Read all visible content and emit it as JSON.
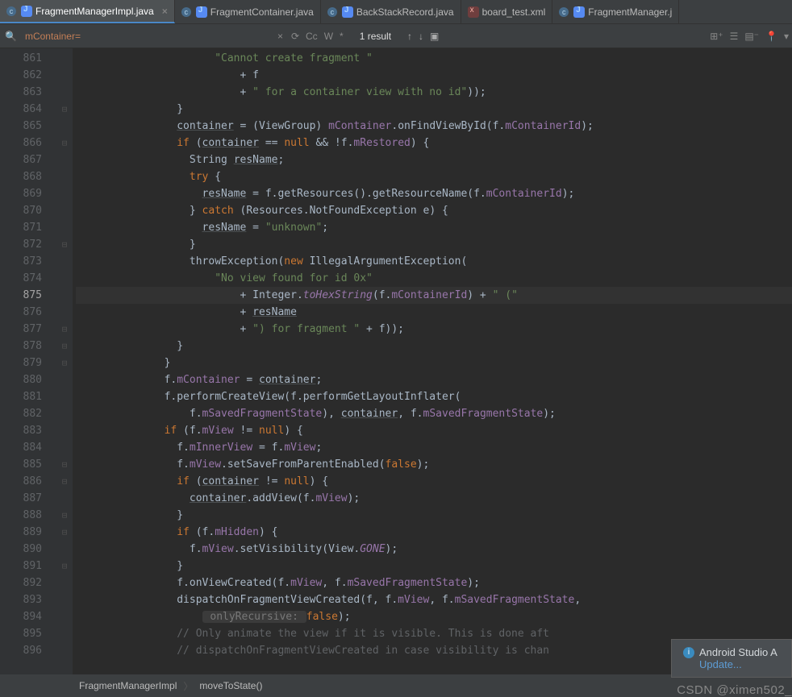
{
  "tabs": [
    {
      "label": "FragmentManagerImpl.java",
      "icon": "java",
      "active": true,
      "c": true
    },
    {
      "label": "FragmentContainer.java",
      "icon": "java",
      "c": true
    },
    {
      "label": "BackStackRecord.java",
      "icon": "java",
      "c": true
    },
    {
      "label": "board_test.xml",
      "icon": "xml"
    },
    {
      "label": "FragmentManager.j",
      "icon": "java",
      "c": true
    }
  ],
  "find": {
    "query": "mContainer=",
    "cc": "Cc",
    "w": "W",
    "star": "*",
    "results": "1 result"
  },
  "lines": {
    "start": 861,
    "end": 896,
    "current": 875,
    "folds": {
      "864": "⊟",
      "866": "⊟",
      "872": "⊟",
      "877": "⊟",
      "878": "⊟",
      "879": "⊟",
      "880": "",
      "885": "⊟",
      "886": "⊟",
      "888": "⊟",
      "889": "⊟",
      "891": "⊟"
    }
  },
  "code": {
    "861": {
      "indent": 22,
      "pre": "",
      "tokens": [
        [
          "str",
          "\"Cannot create fragment \""
        ]
      ]
    },
    "862": {
      "indent": 26,
      "tokens": [
        [
          "op",
          "+ f"
        ]
      ]
    },
    "863": {
      "indent": 26,
      "tokens": [
        [
          "op",
          "+ "
        ],
        [
          "str",
          "\" for a container view with no id\""
        ],
        [
          "op",
          "));"
        ]
      ]
    },
    "864": {
      "indent": 16,
      "tokens": [
        [
          "op",
          "}"
        ]
      ]
    },
    "865": {
      "indent": 16,
      "tokens": [
        [
          "varu",
          "container"
        ],
        [
          "op",
          " = (ViewGroup) "
        ],
        [
          "field",
          "mContainer"
        ],
        [
          "op",
          "."
        ],
        [
          "meth",
          "onFindViewById"
        ],
        [
          "op",
          "(f."
        ],
        [
          "field",
          "mContainerId"
        ],
        [
          "op",
          ");"
        ]
      ]
    },
    "866": {
      "indent": 16,
      "tokens": [
        [
          "kw",
          "if"
        ],
        [
          "op",
          " ("
        ],
        [
          "varu",
          "container"
        ],
        [
          "op",
          " == "
        ],
        [
          "null",
          "null"
        ],
        [
          "op",
          " && !f."
        ],
        [
          "field",
          "mRestored"
        ],
        [
          "op",
          ") {"
        ]
      ]
    },
    "867": {
      "indent": 18,
      "tokens": [
        [
          "type",
          "String "
        ],
        [
          "varu",
          "resName"
        ],
        [
          "op",
          ";"
        ]
      ]
    },
    "868": {
      "indent": 18,
      "tokens": [
        [
          "kw",
          "try"
        ],
        [
          "op",
          " {"
        ]
      ]
    },
    "869": {
      "indent": 20,
      "tokens": [
        [
          "varu",
          "resName"
        ],
        [
          "op",
          " = f.getResources().getResourceName(f."
        ],
        [
          "field",
          "mContainerId"
        ],
        [
          "op",
          ");"
        ]
      ]
    },
    "870": {
      "indent": 18,
      "tokens": [
        [
          "op",
          "} "
        ],
        [
          "kw",
          "catch"
        ],
        [
          "op",
          " (Resources.NotFoundException e) {"
        ]
      ]
    },
    "871": {
      "indent": 20,
      "tokens": [
        [
          "varu",
          "resName"
        ],
        [
          "op",
          " = "
        ],
        [
          "str",
          "\"unknown\""
        ],
        [
          "op",
          ";"
        ]
      ]
    },
    "872": {
      "indent": 18,
      "tokens": [
        [
          "op",
          "}"
        ]
      ]
    },
    "873": {
      "indent": 18,
      "tokens": [
        [
          "meth",
          "throwException"
        ],
        [
          "op",
          "("
        ],
        [
          "kw",
          "new"
        ],
        [
          "op",
          " IllegalArgumentException("
        ]
      ]
    },
    "874": {
      "indent": 22,
      "tokens": [
        [
          "str",
          "\"No view found for id 0x\""
        ]
      ]
    },
    "875": {
      "indent": 26,
      "tokens": [
        [
          "op",
          "+ Integer."
        ],
        [
          "static",
          "toHexString"
        ],
        [
          "op",
          "(f."
        ],
        [
          "field",
          "mContainerId"
        ],
        [
          "op",
          ") + "
        ],
        [
          "str",
          "\" (\""
        ]
      ]
    },
    "876": {
      "indent": 26,
      "tokens": [
        [
          "op",
          "+ "
        ],
        [
          "varu",
          "resName"
        ]
      ]
    },
    "877": {
      "indent": 26,
      "tokens": [
        [
          "op",
          "+ "
        ],
        [
          "str",
          "\") for fragment \""
        ],
        [
          "op",
          " + f));"
        ]
      ]
    },
    "878": {
      "indent": 16,
      "tokens": [
        [
          "op",
          "}"
        ]
      ]
    },
    "879": {
      "indent": 14,
      "tokens": [
        [
          "op",
          "}"
        ]
      ]
    },
    "880": {
      "indent": 14,
      "tokens": [
        [
          "op",
          "f."
        ],
        [
          "field",
          "mContainer"
        ],
        [
          "op",
          " = "
        ],
        [
          "varu",
          "container"
        ],
        [
          "op",
          ";"
        ]
      ]
    },
    "881": {
      "indent": 14,
      "tokens": [
        [
          "op",
          "f.performCreateView(f.performGetLayoutInflater("
        ]
      ]
    },
    "882": {
      "indent": 18,
      "tokens": [
        [
          "op",
          "f."
        ],
        [
          "field",
          "mSavedFragmentState"
        ],
        [
          "op",
          "), "
        ],
        [
          "varu",
          "container"
        ],
        [
          "op",
          ", f."
        ],
        [
          "field",
          "mSavedFragmentState"
        ],
        [
          "op",
          ");"
        ]
      ]
    },
    "883": {
      "indent": 14,
      "tokens": [
        [
          "kw",
          "if"
        ],
        [
          "op",
          " (f."
        ],
        [
          "field",
          "mView"
        ],
        [
          "op",
          " != "
        ],
        [
          "null",
          "null"
        ],
        [
          "op",
          ") {"
        ]
      ]
    },
    "884": {
      "indent": 16,
      "tokens": [
        [
          "op",
          "f."
        ],
        [
          "field",
          "mInnerView"
        ],
        [
          "op",
          " = f."
        ],
        [
          "field",
          "mView"
        ],
        [
          "op",
          ";"
        ]
      ]
    },
    "885": {
      "indent": 16,
      "tokens": [
        [
          "op",
          "f."
        ],
        [
          "field",
          "mView"
        ],
        [
          "op",
          ".setSaveFromParentEnabled("
        ],
        [
          "kw",
          "false"
        ],
        [
          "op",
          ");"
        ]
      ]
    },
    "886": {
      "indent": 16,
      "tokens": [
        [
          "kw",
          "if"
        ],
        [
          "op",
          " ("
        ],
        [
          "varu",
          "container"
        ],
        [
          "op",
          " != "
        ],
        [
          "null",
          "null"
        ],
        [
          "op",
          ") {"
        ]
      ]
    },
    "887": {
      "indent": 18,
      "tokens": [
        [
          "varu",
          "container"
        ],
        [
          "op",
          ".addView(f."
        ],
        [
          "field",
          "mView"
        ],
        [
          "op",
          ");"
        ]
      ]
    },
    "888": {
      "indent": 16,
      "tokens": [
        [
          "op",
          "}"
        ]
      ]
    },
    "889": {
      "indent": 16,
      "tokens": [
        [
          "kw",
          "if"
        ],
        [
          "op",
          " (f."
        ],
        [
          "field",
          "mHidden"
        ],
        [
          "op",
          ") {"
        ]
      ]
    },
    "890": {
      "indent": 18,
      "tokens": [
        [
          "op",
          "f."
        ],
        [
          "field",
          "mView"
        ],
        [
          "op",
          ".setVisibility(View."
        ],
        [
          "static",
          "GONE"
        ],
        [
          "op",
          ");"
        ]
      ]
    },
    "891": {
      "indent": 16,
      "tokens": [
        [
          "op",
          "}"
        ]
      ]
    },
    "892": {
      "indent": 16,
      "tokens": [
        [
          "op",
          "f.onViewCreated(f."
        ],
        [
          "field",
          "mView"
        ],
        [
          "op",
          ", f."
        ],
        [
          "field",
          "mSavedFragmentState"
        ],
        [
          "op",
          ");"
        ]
      ]
    },
    "893": {
      "indent": 16,
      "tokens": [
        [
          "op",
          "dispatchOnFragmentViewCreated(f, f."
        ],
        [
          "field",
          "mView"
        ],
        [
          "op",
          ", f."
        ],
        [
          "field",
          "mSavedFragmentState"
        ],
        [
          "op",
          ","
        ]
      ]
    },
    "894": {
      "indent": 20,
      "tokens": [
        [
          "hint",
          " onlyRecursive: "
        ],
        [
          "kw",
          "false"
        ],
        [
          "op",
          ");"
        ]
      ]
    },
    "895": {
      "indent": 16,
      "tokens": [
        [
          "comment",
          "// Only animate the view if it is visible. This is done aft"
        ]
      ]
    },
    "896": {
      "indent": 16,
      "tokens": [
        [
          "comment",
          "// dispatchOnFragmentViewCreated in case visibility is chan"
        ]
      ]
    }
  },
  "breadcrumbs": [
    "FragmentManagerImpl",
    "moveToState()"
  ],
  "notification": {
    "title": "Android Studio A",
    "link": "Update..."
  },
  "watermark": "CSDN @ximen502_"
}
